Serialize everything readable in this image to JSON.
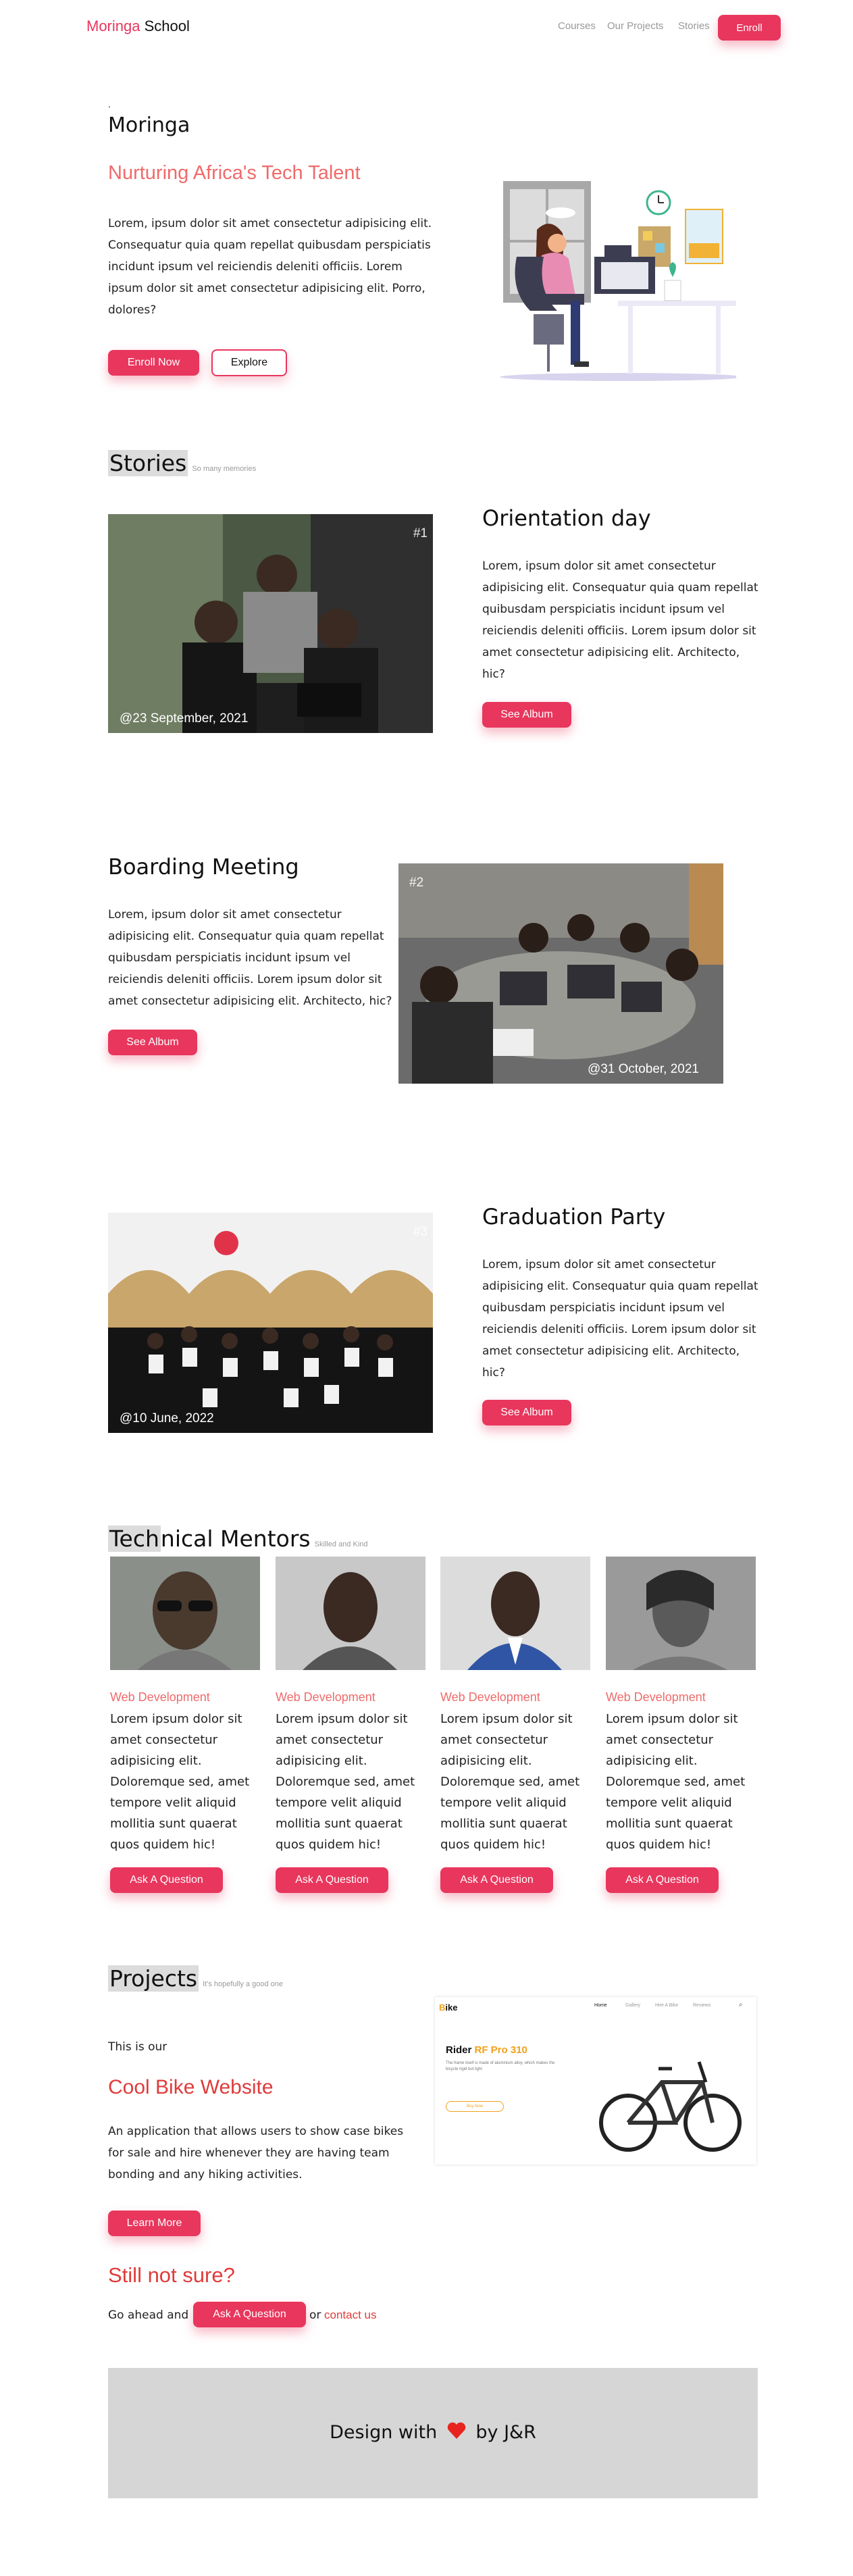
{
  "nav": {
    "brand_part1": "Moringa",
    "brand_part2": "School",
    "links": [
      "Courses",
      "Our Projects",
      "Stories"
    ],
    "enroll_label": "Enroll"
  },
  "hero": {
    "dot": ".",
    "title": "Moringa",
    "subtitle": "Nurturing Africa's Tech Talent",
    "text": "Lorem, ipsum dolor sit amet consectetur adipisicing elit. Consequatur quia quam repellat quibusdam perspiciatis incidunt ipsum vel reiciendis deleniti officiis. Lorem ipsum dolor sit amet consectetur adipisicing elit. Porro, dolores?",
    "enroll_now_label": "Enroll Now",
    "explore_label": "Explore"
  },
  "stories": {
    "heading_hl": "Stories",
    "heading_rest": "",
    "small": "So many memories",
    "items": [
      {
        "num": "#1",
        "date": "@23 September, 2021",
        "title": "Orientation day",
        "text": "Lorem, ipsum dolor sit amet consectetur adipisicing elit. Consequatur quia quam repellat quibusdam perspiciatis incidunt ipsum vel reiciendis deleniti officiis. Lorem ipsum dolor sit amet consectetur adipisicing elit. Architecto, hic?",
        "button": "See Album"
      },
      {
        "num": "#2",
        "date": "@31 October, 2021",
        "title": "Boarding Meeting",
        "text": "Lorem, ipsum dolor sit amet consectetur adipisicing elit. Consequatur quia quam repellat quibusdam perspiciatis incidunt ipsum vel reiciendis deleniti officiis. Lorem ipsum dolor sit amet consectetur adipisicing elit. Architecto, hic?",
        "button": "See Album"
      },
      {
        "num": "#3",
        "date": "@10 June, 2022",
        "title": "Graduation Party",
        "text": "Lorem, ipsum dolor sit amet consectetur adipisicing elit. Consequatur quia quam repellat quibusdam perspiciatis incidunt ipsum vel reiciendis deleniti officiis. Lorem ipsum dolor sit amet consectetur adipisicing elit. Architecto, hic?",
        "button": "See Album"
      }
    ]
  },
  "mentors": {
    "heading_hl": "Tech",
    "heading_rest": "nical Mentors",
    "small": "Skilled and Kind",
    "items": [
      {
        "role": "Web Development",
        "text": "Lorem ipsum dolor sit amet consectetur adipisicing elit. Doloremque sed, amet tempore velit aliquid mollitia sunt quaerat quos quidem hic!",
        "button": "Ask A Question"
      },
      {
        "role": "Web Development",
        "text": "Lorem ipsum dolor sit amet consectetur adipisicing elit. Doloremque sed, amet tempore velit aliquid mollitia sunt quaerat quos quidem hic!",
        "button": "Ask A Question"
      },
      {
        "role": "Web Development",
        "text": "Lorem ipsum dolor sit amet consectetur adipisicing elit. Doloremque sed, amet tempore velit aliquid mollitia sunt quaerat quos quidem hic!",
        "button": "Ask A Question"
      },
      {
        "role": "Web Development",
        "text": "Lorem ipsum dolor sit amet consectetur adipisicing elit. Doloremque sed, amet tempore velit aliquid mollitia sunt quaerat quos quidem hic!",
        "button": "Ask A Question"
      }
    ]
  },
  "projects": {
    "heading_hl": "Projects",
    "small": "It's hopefully a good one",
    "intro": "This is our",
    "title": "Cool Bike Website",
    "text": "An application that allows users to show case bikes for sale and hire whenever they are having team bonding and any hiking activities.",
    "button": "Learn More",
    "preview": {
      "logo_b": "B",
      "logo_rest": "ike",
      "nav": [
        "Home",
        "Gallery",
        "Hire A Bike",
        "Reviews"
      ],
      "title_a": "Rider",
      "title_b": "RF Pro 310",
      "desc": "The frame itself is made of aluminium alloy, which makes the bicycle rigid but light",
      "cta": "Buy Now"
    }
  },
  "cta": {
    "title": "Still not sure?",
    "go_ahead": "Go ahead and",
    "ask_button": "Ask A Question",
    "or": "or",
    "contact": "contact us"
  },
  "footer": {
    "text_before": "Design with",
    "text_after": "by J&R"
  },
  "colors": {
    "accent": "#e8365d",
    "accent_soft": "#f06a6a",
    "footer_bg": "#d6d6d6"
  }
}
